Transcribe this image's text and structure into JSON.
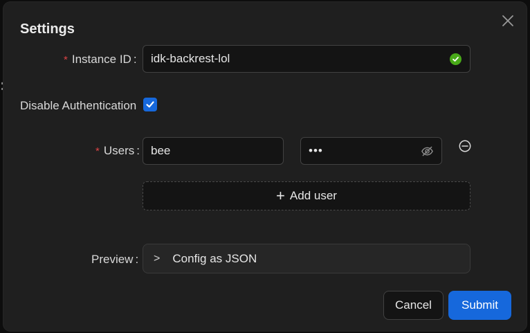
{
  "dialog": {
    "title": "Settings"
  },
  "instance_field": {
    "required_mark": "*",
    "label": "Instance ID",
    "colon": ":",
    "value": "idk-backrest-lol",
    "valid_icon": "check-circle-icon"
  },
  "auth": {
    "label": "Disable Authentication",
    "checked": true
  },
  "users_field": {
    "required_mark": "*",
    "label": "Users",
    "colon": ":",
    "username": "bee",
    "password_mask": "•••",
    "password_icon": "eye-invisible-icon",
    "remove_icon": "minus-circle-icon"
  },
  "add_user": {
    "icon": "+",
    "label": "Add user"
  },
  "preview": {
    "label": "Preview",
    "colon": ":",
    "chevron": ">",
    "panel_label": "Config as JSON"
  },
  "footer": {
    "cancel_label": "Cancel",
    "submit_label": "Submit"
  },
  "colors": {
    "primary": "#1668dc",
    "success": "#49aa19",
    "required": "#dc4446",
    "modal_bg": "#1f1f1f"
  }
}
